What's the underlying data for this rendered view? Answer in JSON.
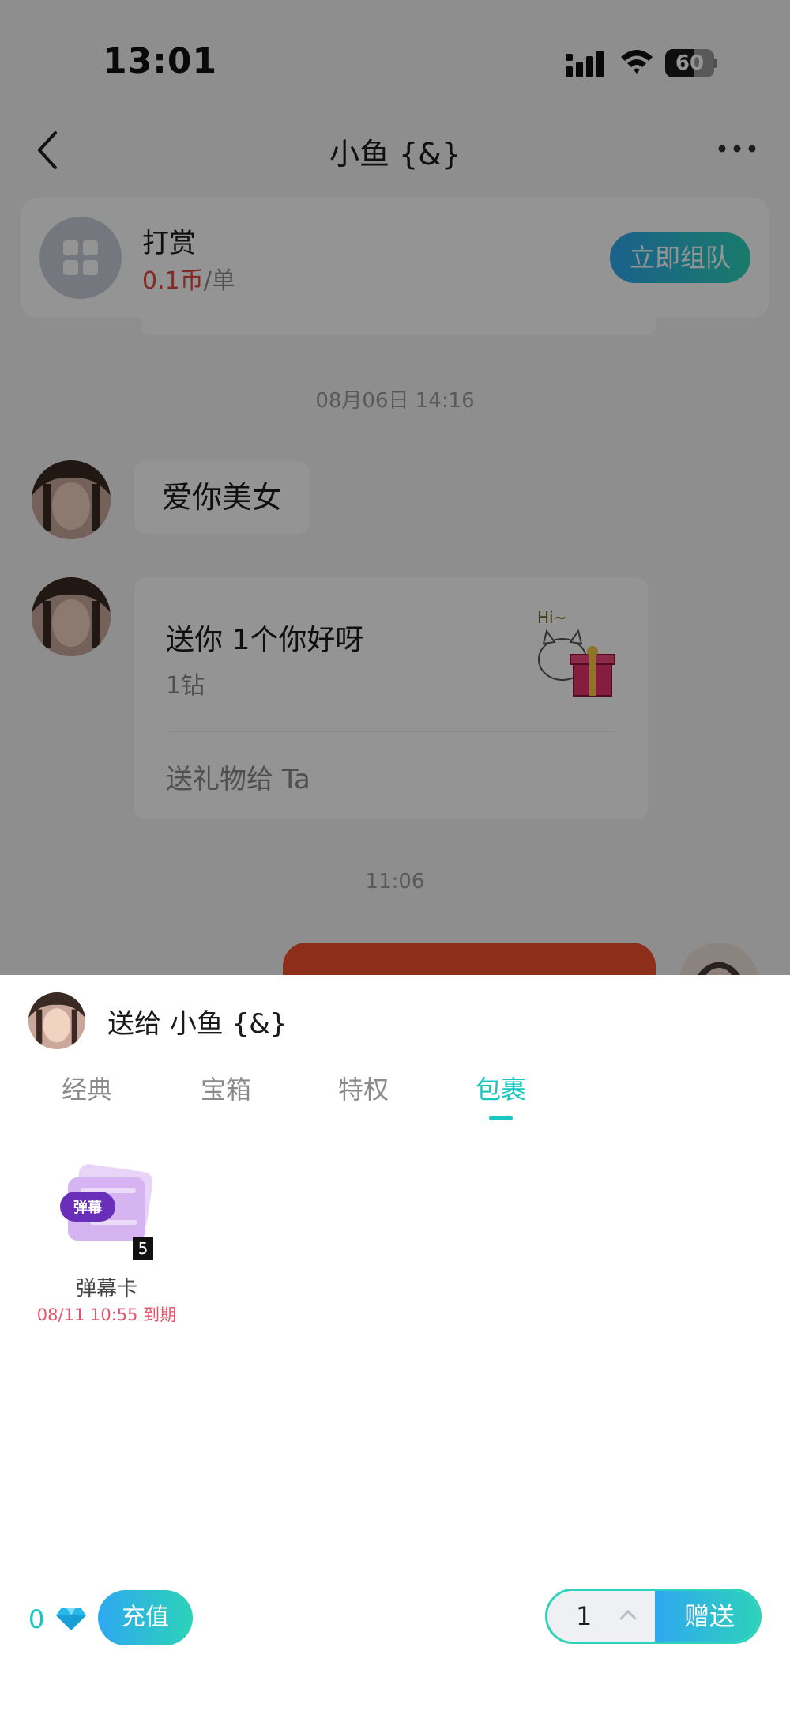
{
  "status_bar": {
    "time": "13:01",
    "battery": "60",
    "battery_level": 0.6
  },
  "nav": {
    "title": "小鱼 {&}",
    "back_icon": "chevron-left-icon",
    "more_icon": "more-dots-icon"
  },
  "reward_card": {
    "title": "打赏",
    "price_value": "0.1币",
    "price_unit": "/单",
    "button_label": "立即组队",
    "icon": "grid-apps-icon"
  },
  "chat": {
    "timestamp_1": "08月06日 14:16",
    "message_1": "爱你美女",
    "gift_message": {
      "title": "送你 1个你好呀",
      "subtitle": "1钻",
      "action": "送礼物给 Ta",
      "sticker_text": "Hi~"
    },
    "timestamp_2": "11:06"
  },
  "sheet": {
    "recipient_label": "送给 小鱼 {&}",
    "tabs": [
      {
        "label": "经典",
        "active": false
      },
      {
        "label": "宝箱",
        "active": false
      },
      {
        "label": "特权",
        "active": false
      },
      {
        "label": "包裹",
        "active": true
      }
    ],
    "items": [
      {
        "name": "弹幕卡",
        "badge_text": "弹幕",
        "count": "5",
        "expiry": "08/11 10:55 到期"
      }
    ],
    "balance": "0",
    "recharge_label": "充值",
    "quantity": "1",
    "send_label": "赠送"
  },
  "colors": {
    "accent": "#19c7c0",
    "gradient_start": "#2fa8f0",
    "gradient_end": "#2cd3b8",
    "price_red": "#e24a3f",
    "expiry_red": "#e0556a"
  }
}
